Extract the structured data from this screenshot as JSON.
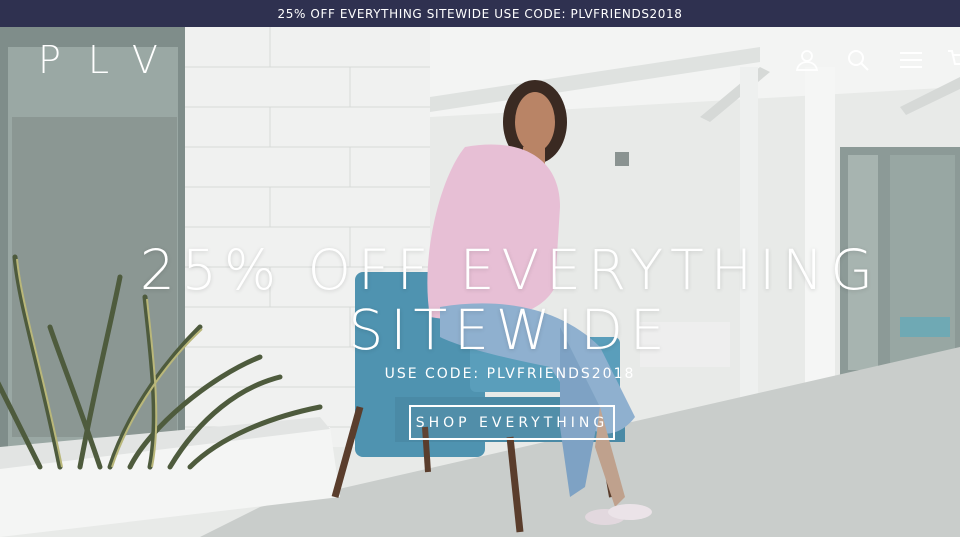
{
  "announcement": {
    "text": "25% OFF EVERYTHING SITEWIDE USE CODE: PLVFRIENDS2018"
  },
  "header": {
    "logo": "PLV",
    "icons": [
      "account-icon",
      "search-icon",
      "menu-icon",
      "cart-icon"
    ]
  },
  "hero": {
    "headline_line1": "25% OFF EVERYTHING",
    "headline_line2": "SITEWIDE",
    "subheadline": "USE CODE: PLVFRIENDS2018",
    "cta_label": "SHOP EVERYTHING"
  },
  "colors": {
    "announcement_bg": "#2f3150",
    "text": "#ffffff"
  }
}
